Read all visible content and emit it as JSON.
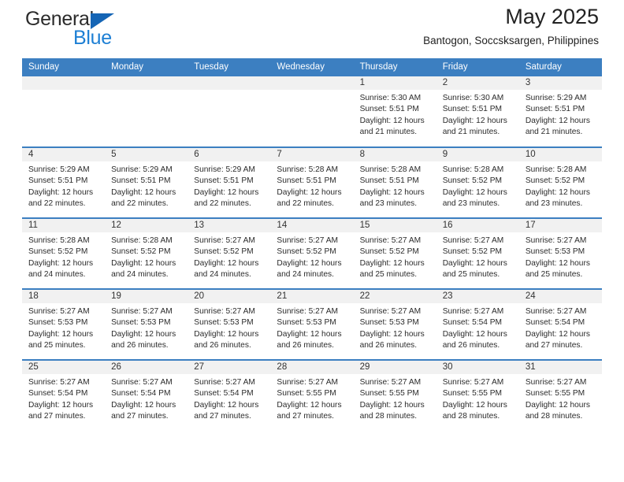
{
  "brand": {
    "line1": "General",
    "line2": "Blue",
    "triangle_color": "#1565b5",
    "line2_color": "#1d7fd4"
  },
  "header": {
    "title": "May 2025",
    "location": "Bantogon, Soccsksargen, Philippines"
  },
  "theme": {
    "header_bar_color": "#3c7fc1",
    "daynum_band_color": "#f1f1f1",
    "cell_background": "#ffffff",
    "text_color": "#2b2b2b"
  },
  "weekday_headers": [
    "Sunday",
    "Monday",
    "Tuesday",
    "Wednesday",
    "Thursday",
    "Friday",
    "Saturday"
  ],
  "weeks": [
    [
      {
        "day": "",
        "empty": true
      },
      {
        "day": "",
        "empty": true
      },
      {
        "day": "",
        "empty": true
      },
      {
        "day": "",
        "empty": true
      },
      {
        "day": "1",
        "sunrise": "Sunrise: 5:30 AM",
        "sunset": "Sunset: 5:51 PM",
        "daylight1": "Daylight: 12 hours",
        "daylight2": "and 21 minutes."
      },
      {
        "day": "2",
        "sunrise": "Sunrise: 5:30 AM",
        "sunset": "Sunset: 5:51 PM",
        "daylight1": "Daylight: 12 hours",
        "daylight2": "and 21 minutes."
      },
      {
        "day": "3",
        "sunrise": "Sunrise: 5:29 AM",
        "sunset": "Sunset: 5:51 PM",
        "daylight1": "Daylight: 12 hours",
        "daylight2": "and 21 minutes."
      }
    ],
    [
      {
        "day": "4",
        "sunrise": "Sunrise: 5:29 AM",
        "sunset": "Sunset: 5:51 PM",
        "daylight1": "Daylight: 12 hours",
        "daylight2": "and 22 minutes."
      },
      {
        "day": "5",
        "sunrise": "Sunrise: 5:29 AM",
        "sunset": "Sunset: 5:51 PM",
        "daylight1": "Daylight: 12 hours",
        "daylight2": "and 22 minutes."
      },
      {
        "day": "6",
        "sunrise": "Sunrise: 5:29 AM",
        "sunset": "Sunset: 5:51 PM",
        "daylight1": "Daylight: 12 hours",
        "daylight2": "and 22 minutes."
      },
      {
        "day": "7",
        "sunrise": "Sunrise: 5:28 AM",
        "sunset": "Sunset: 5:51 PM",
        "daylight1": "Daylight: 12 hours",
        "daylight2": "and 22 minutes."
      },
      {
        "day": "8",
        "sunrise": "Sunrise: 5:28 AM",
        "sunset": "Sunset: 5:51 PM",
        "daylight1": "Daylight: 12 hours",
        "daylight2": "and 23 minutes."
      },
      {
        "day": "9",
        "sunrise": "Sunrise: 5:28 AM",
        "sunset": "Sunset: 5:52 PM",
        "daylight1": "Daylight: 12 hours",
        "daylight2": "and 23 minutes."
      },
      {
        "day": "10",
        "sunrise": "Sunrise: 5:28 AM",
        "sunset": "Sunset: 5:52 PM",
        "daylight1": "Daylight: 12 hours",
        "daylight2": "and 23 minutes."
      }
    ],
    [
      {
        "day": "11",
        "sunrise": "Sunrise: 5:28 AM",
        "sunset": "Sunset: 5:52 PM",
        "daylight1": "Daylight: 12 hours",
        "daylight2": "and 24 minutes."
      },
      {
        "day": "12",
        "sunrise": "Sunrise: 5:28 AM",
        "sunset": "Sunset: 5:52 PM",
        "daylight1": "Daylight: 12 hours",
        "daylight2": "and 24 minutes."
      },
      {
        "day": "13",
        "sunrise": "Sunrise: 5:27 AM",
        "sunset": "Sunset: 5:52 PM",
        "daylight1": "Daylight: 12 hours",
        "daylight2": "and 24 minutes."
      },
      {
        "day": "14",
        "sunrise": "Sunrise: 5:27 AM",
        "sunset": "Sunset: 5:52 PM",
        "daylight1": "Daylight: 12 hours",
        "daylight2": "and 24 minutes."
      },
      {
        "day": "15",
        "sunrise": "Sunrise: 5:27 AM",
        "sunset": "Sunset: 5:52 PM",
        "daylight1": "Daylight: 12 hours",
        "daylight2": "and 25 minutes."
      },
      {
        "day": "16",
        "sunrise": "Sunrise: 5:27 AM",
        "sunset": "Sunset: 5:52 PM",
        "daylight1": "Daylight: 12 hours",
        "daylight2": "and 25 minutes."
      },
      {
        "day": "17",
        "sunrise": "Sunrise: 5:27 AM",
        "sunset": "Sunset: 5:53 PM",
        "daylight1": "Daylight: 12 hours",
        "daylight2": "and 25 minutes."
      }
    ],
    [
      {
        "day": "18",
        "sunrise": "Sunrise: 5:27 AM",
        "sunset": "Sunset: 5:53 PM",
        "daylight1": "Daylight: 12 hours",
        "daylight2": "and 25 minutes."
      },
      {
        "day": "19",
        "sunrise": "Sunrise: 5:27 AM",
        "sunset": "Sunset: 5:53 PM",
        "daylight1": "Daylight: 12 hours",
        "daylight2": "and 26 minutes."
      },
      {
        "day": "20",
        "sunrise": "Sunrise: 5:27 AM",
        "sunset": "Sunset: 5:53 PM",
        "daylight1": "Daylight: 12 hours",
        "daylight2": "and 26 minutes."
      },
      {
        "day": "21",
        "sunrise": "Sunrise: 5:27 AM",
        "sunset": "Sunset: 5:53 PM",
        "daylight1": "Daylight: 12 hours",
        "daylight2": "and 26 minutes."
      },
      {
        "day": "22",
        "sunrise": "Sunrise: 5:27 AM",
        "sunset": "Sunset: 5:53 PM",
        "daylight1": "Daylight: 12 hours",
        "daylight2": "and 26 minutes."
      },
      {
        "day": "23",
        "sunrise": "Sunrise: 5:27 AM",
        "sunset": "Sunset: 5:54 PM",
        "daylight1": "Daylight: 12 hours",
        "daylight2": "and 26 minutes."
      },
      {
        "day": "24",
        "sunrise": "Sunrise: 5:27 AM",
        "sunset": "Sunset: 5:54 PM",
        "daylight1": "Daylight: 12 hours",
        "daylight2": "and 27 minutes."
      }
    ],
    [
      {
        "day": "25",
        "sunrise": "Sunrise: 5:27 AM",
        "sunset": "Sunset: 5:54 PM",
        "daylight1": "Daylight: 12 hours",
        "daylight2": "and 27 minutes."
      },
      {
        "day": "26",
        "sunrise": "Sunrise: 5:27 AM",
        "sunset": "Sunset: 5:54 PM",
        "daylight1": "Daylight: 12 hours",
        "daylight2": "and 27 minutes."
      },
      {
        "day": "27",
        "sunrise": "Sunrise: 5:27 AM",
        "sunset": "Sunset: 5:54 PM",
        "daylight1": "Daylight: 12 hours",
        "daylight2": "and 27 minutes."
      },
      {
        "day": "28",
        "sunrise": "Sunrise: 5:27 AM",
        "sunset": "Sunset: 5:55 PM",
        "daylight1": "Daylight: 12 hours",
        "daylight2": "and 27 minutes."
      },
      {
        "day": "29",
        "sunrise": "Sunrise: 5:27 AM",
        "sunset": "Sunset: 5:55 PM",
        "daylight1": "Daylight: 12 hours",
        "daylight2": "and 28 minutes."
      },
      {
        "day": "30",
        "sunrise": "Sunrise: 5:27 AM",
        "sunset": "Sunset: 5:55 PM",
        "daylight1": "Daylight: 12 hours",
        "daylight2": "and 28 minutes."
      },
      {
        "day": "31",
        "sunrise": "Sunrise: 5:27 AM",
        "sunset": "Sunset: 5:55 PM",
        "daylight1": "Daylight: 12 hours",
        "daylight2": "and 28 minutes."
      }
    ]
  ]
}
